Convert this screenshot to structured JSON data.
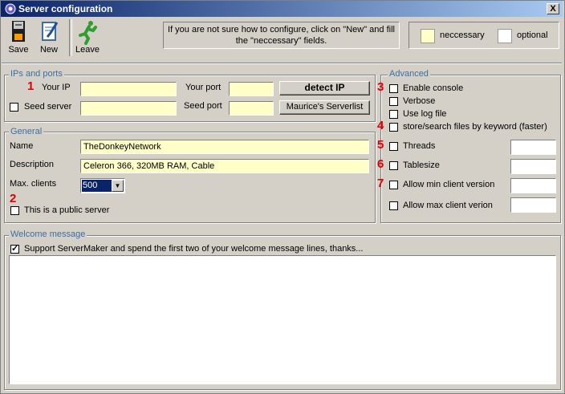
{
  "window": {
    "title": "Server configuration",
    "close_label": "X"
  },
  "toolbar": {
    "save_label": "Save",
    "new_label": "New",
    "leave_label": "Leave"
  },
  "hint": {
    "line1": "If you are not sure how to configure, click on \"New\" and fill",
    "line2": "the \"neccessary\" fields."
  },
  "legend": {
    "necessary_label": "neccessary",
    "optional_label": "optional",
    "necessary_color": "#ffffc8",
    "optional_color": "#ffffff"
  },
  "ips": {
    "group_title": "IPs and ports",
    "your_ip_label": "Your IP",
    "your_ip_value": "",
    "your_port_label": "Your port",
    "your_port_value": "",
    "detect_ip_label": "detect IP",
    "seed_server_label": "Seed server",
    "seed_server_checked": false,
    "seed_server_value": "",
    "seed_port_label": "Seed port",
    "seed_port_value": "",
    "serverlist_label": "Maurice's Serverlist"
  },
  "general": {
    "group_title": "General",
    "name_label": "Name",
    "name_value": "TheDonkeyNetwork",
    "description_label": "Description",
    "description_value": "Celeron   366, 320MB RAM, Cable",
    "max_clients_label": "Max. clients",
    "max_clients_value": "500",
    "public_label": "This is a public server",
    "public_checked": false
  },
  "advanced": {
    "group_title": "Advanced",
    "enable_console": "Enable console",
    "verbose": "Verbose",
    "use_log_file": "Use log file",
    "store_search": "store/search files by keyword (faster)",
    "threads": "Threads",
    "threads_value": "",
    "tablesize": "Tablesize",
    "tablesize_value": "",
    "allow_min": "Allow min client version",
    "allow_min_value": "",
    "allow_max": "Allow max client verion",
    "allow_max_value": ""
  },
  "welcome": {
    "group_title": "Welcome message",
    "support_label": "Support ServerMaker and spend the first two of your welcome message lines, thanks...",
    "support_checked": true,
    "message_value": ""
  },
  "markers": {
    "m1": "1",
    "m2": "2",
    "m3": "3",
    "m4": "4",
    "m5": "5",
    "m6": "6",
    "m7": "7",
    "color": "#e00000"
  }
}
